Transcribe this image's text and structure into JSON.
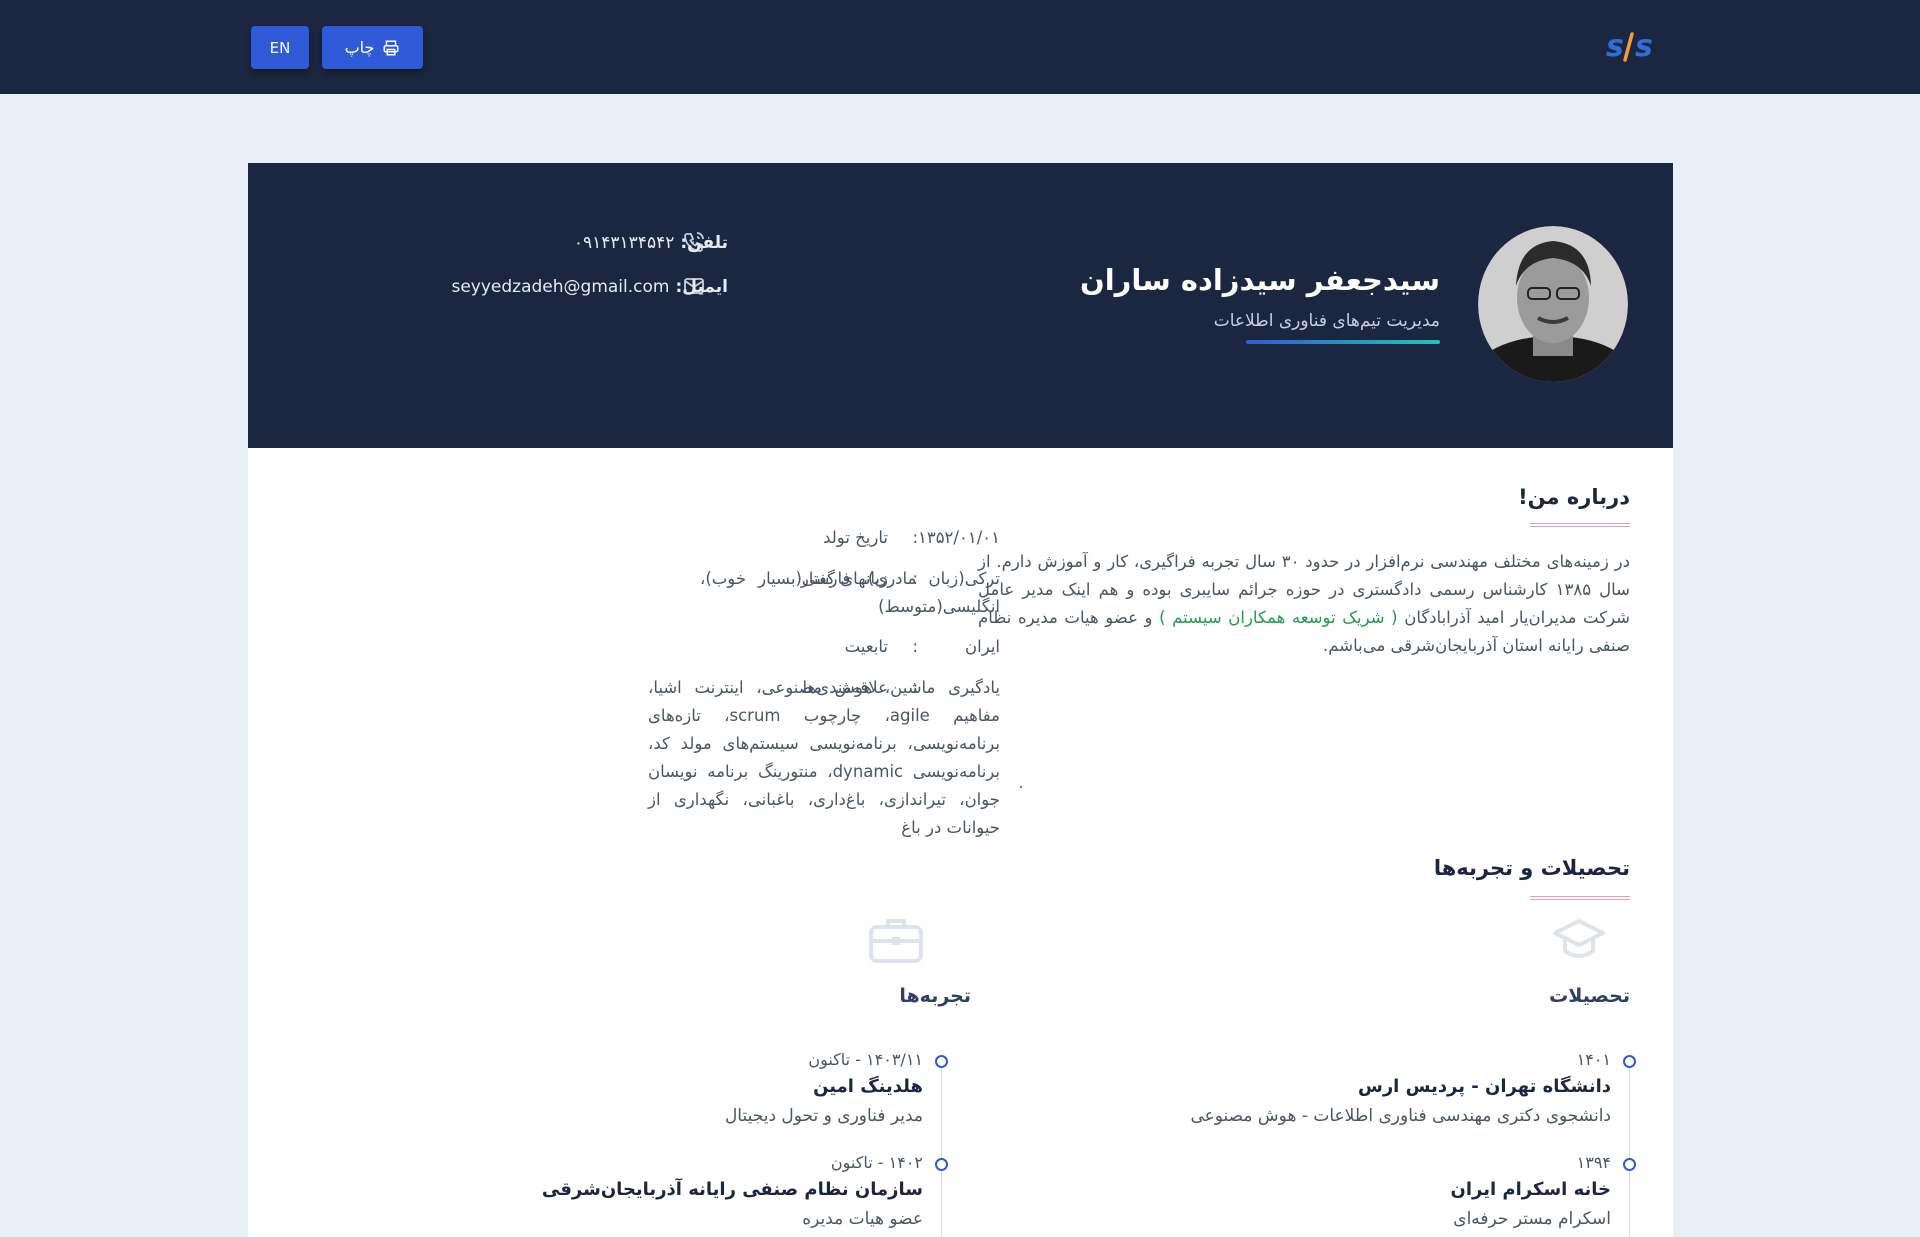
{
  "header": {
    "print_label": "چاپ",
    "lang_label": "EN",
    "logo_icon": "sjs-logo"
  },
  "profile": {
    "name": "سیدجعفر سیدزاده ساران",
    "job_title": "مدیریت تیم‌های فناوری اطلاعات",
    "phone_label": "تلفن:",
    "phone": "۰۹۱۴۳۱۳۴۵۴۲",
    "email_label": "ایمیل:",
    "email": "seyyedzadeh@gmail.com"
  },
  "about": {
    "title": "درباره من!",
    "text_before": "در زمینه‌های مختلف مهندسی نرم‌افزار در حدود ۳۰ سال تجربه فراگیری، کار و آموزش دارم. از سال ۱۳۸۵ کارشناس رسمی دادگستری در حوزه جرائم سایبری بوده و هم اینک مدیر عامل شرکت مدیران‌یار امید آذرابادگان ",
    "highlight": "( شریک توسعه همکاران سیستم )",
    "text_after": " و عضو هیات مدیره نظام صنفی رایانه استان آذربایجان‌شرقی می‌باشم."
  },
  "info": {
    "colon": ":",
    "birth_label": "تاریخ تولد",
    "birth_value": "۱۳۵۲/۰۱/۰۱",
    "languages_label": "زبانهای گفتار",
    "languages_value": "ترکی(زبان مادری)، فارسی(بسیار خوب)، انگلیسی(متوسط)",
    "nationality_label": "تابعیت",
    "nationality_value": "ایران",
    "interests_label": "علاقه‌مندی‌ها",
    "interests_value": "یادگیری ماشین، هوش مصنوعی، اینترنت اشیا، مفاهیم agile، چارچوب scrum، تازه‌های برنامه‌نویسی، برنامه‌نویسی سیستم‌های مولد کد، برنامه‌نویسی dynamic، منتورینگ برنامه نویسان جوان، تیراندازی، باغ‌داری، باغبانی، نگهداری از حیوانات در باغ"
  },
  "resume": {
    "title": "تحصیلات و تجربه‌ها",
    "education": {
      "title": "تحصیلات",
      "icon": "graduation-cap-icon",
      "items": [
        {
          "date": "۱۴۰۱",
          "title": "دانشگاه تهران - پردیس ارس",
          "desc": "دانشجوی دکتری مهندسی فناوری اطلاعات - هوش مصنوعی"
        },
        {
          "date": "۱۳۹۴",
          "title": "خانه اسکرام ایران",
          "desc": "اسکرام مستر حرفه‌ای"
        }
      ]
    },
    "experience": {
      "title": "تجربه‌ها",
      "icon": "briefcase-icon",
      "items": [
        {
          "date": "۱۴۰۳/۱۱ - تاکنون",
          "title": "هلدینگ امین",
          "desc": "مدیر فناوری و تحول دیجیتال"
        },
        {
          "date": "۱۴۰۲ - تاکنون",
          "title": "سازمان نظام صنفی رایانه آذربایجان‌شرقی",
          "desc": "عضو هیات مدیره"
        }
      ]
    }
  },
  "colors": {
    "navy": "#1b2641",
    "accent": "#2f5bd9",
    "highlight": "#1e9e4a"
  }
}
